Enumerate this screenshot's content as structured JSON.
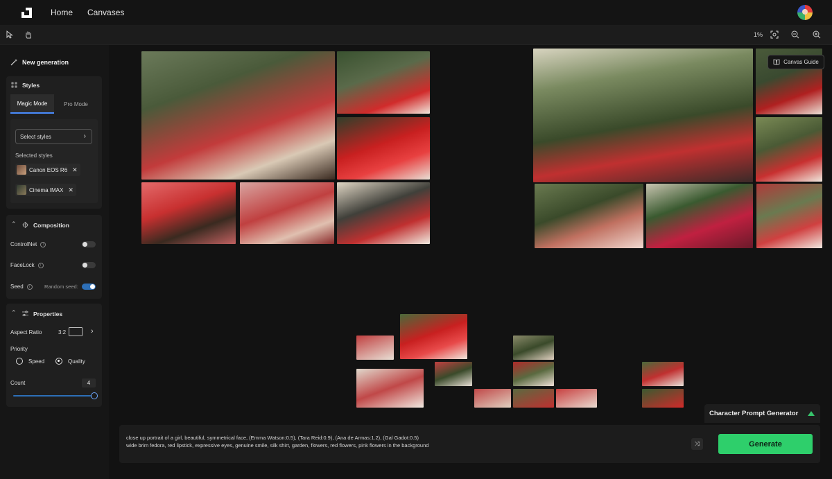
{
  "topbar": {
    "logo_icon": "app-logo-icon",
    "nav": [
      "Home",
      "Canvases"
    ],
    "avatar_icon": "user-avatar"
  },
  "toolbar": {
    "select_icon": "cursor-select-icon",
    "hand_icon": "hand-pan-icon",
    "zoom": "1%",
    "fit_icon": "fit-screen-icon",
    "zoom_out_icon": "zoom-out-icon",
    "zoom_in_icon": "zoom-in-icon"
  },
  "sidebar": {
    "new_generation": "New generation",
    "styles": {
      "title": "Styles",
      "tabs": [
        "Magic Mode",
        "Pro Mode"
      ],
      "select_styles": "Select styles",
      "selected_label": "Selected styles",
      "selected": [
        "Canon EOS R6",
        "Cinema IMAX"
      ]
    },
    "composition": {
      "title": "Composition",
      "controlnet": "ControlNet",
      "facelock": "FaceLock",
      "seed": "Seed",
      "random_seed": "Random seed:"
    },
    "properties": {
      "title": "Properties",
      "aspect_ratio_label": "Aspect Ratio",
      "aspect_ratio_value": "3:2",
      "priority_label": "Priority",
      "priority_options": [
        "Speed",
        "Quality"
      ],
      "priority_selected": "Quality",
      "count_label": "Count",
      "count_value": "4"
    }
  },
  "canvas": {
    "canvas_guide": "Canvas Guide",
    "character_prompt_generator": "Character Prompt Generator"
  },
  "prompt": {
    "line1": "close up portrait of a girl, beautiful, symmetrical face, (Emma Watson:0.5), (Tara Reid:0.9), (Ana de Armas:1.2), (Gal Gadot:0.5)",
    "line2": "wide brim fedora, red lipstick, expressive eyes, genuine smile, silk shirt, garden, flowers, red flowers, pink flowers in the background",
    "generate": "Generate"
  },
  "colors": {
    "accent_green": "#2ecf6b",
    "accent_blue": "#2d6fb7"
  }
}
